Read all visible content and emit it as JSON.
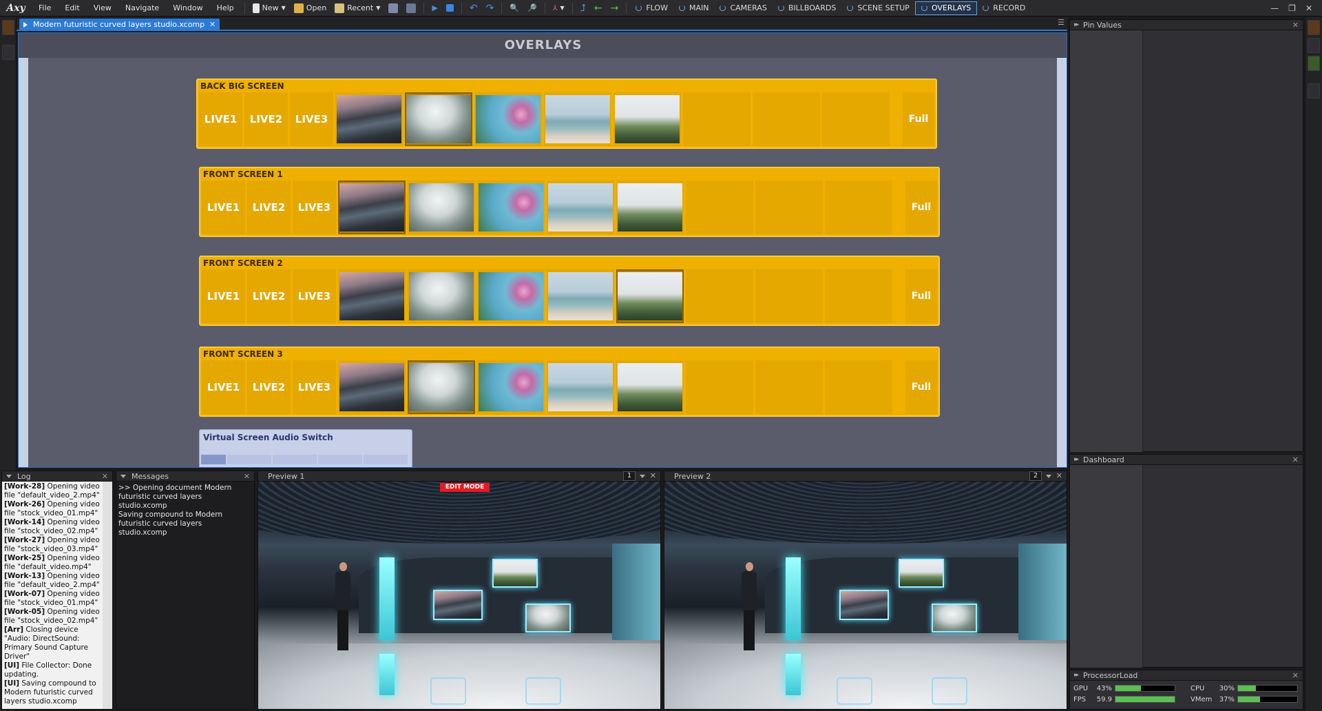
{
  "app": {
    "logo": "Axy"
  },
  "menu": {
    "file": "File",
    "edit": "Edit",
    "view": "View",
    "navigate": "Navigate",
    "window": "Window",
    "help": "Help"
  },
  "toolbar": {
    "new": "New",
    "open": "Open",
    "recent": "Recent"
  },
  "nav": {
    "flow": "FLOW",
    "main": "MAIN",
    "cameras": "CAMERAS",
    "billboards": "BILLBOARDS",
    "scene_setup": "SCENE SETUP",
    "overlays": "OVERLAYS",
    "record": "RECORD"
  },
  "document": {
    "tab": "Modern futuristic curved layers studio.xcomp"
  },
  "canvas": {
    "title": "OVERLAYS"
  },
  "screens": [
    {
      "title": "BACK BIG SCREEN",
      "live": [
        "LIVE1",
        "LIVE2",
        "LIVE3"
      ],
      "full": "Full"
    },
    {
      "title": "FRONT SCREEN 1",
      "live": [
        "LIVE1",
        "LIVE2",
        "LIVE3"
      ],
      "full": "Full"
    },
    {
      "title": "FRONT SCREEN 2",
      "live": [
        "LIVE1",
        "LIVE2",
        "LIVE3"
      ],
      "full": "Full"
    },
    {
      "title": "FRONT SCREEN 3",
      "live": [
        "LIVE1",
        "LIVE2",
        "LIVE3"
      ],
      "full": "Full"
    }
  ],
  "audio_switch": {
    "title": "Virtual Screen Audio Switch"
  },
  "panels": {
    "pin_values": "Pin Values",
    "dashboard": "Dashboard",
    "processor_load": "ProcessorLoad",
    "log": "Log",
    "messages": "Messages",
    "preview1": "Preview 1",
    "preview2": "Preview 2",
    "preview1_num": "1",
    "preview2_num": "2",
    "edit_mode": "EDIT MODE"
  },
  "log": [
    {
      "tag": "[Work-28]",
      "text": " Opening video file \"default_video_2.mp4\""
    },
    {
      "tag": "[Work-26]",
      "text": " Opening video file \"stock_video_01.mp4\""
    },
    {
      "tag": "[Work-14]",
      "text": " Opening video file \"stock_video_02.mp4\""
    },
    {
      "tag": "[Work-27]",
      "text": " Opening video file \"stock_video_03.mp4\""
    },
    {
      "tag": "[Work-25]",
      "text": " Opening video file \"default_video.mp4\""
    },
    {
      "tag": "[Work-13]",
      "text": " Opening video file \"default_video_2.mp4\""
    },
    {
      "tag": "[Work-07]",
      "text": " Opening video file \"stock_video_01.mp4\""
    },
    {
      "tag": "[Work-05]",
      "text": " Opening video file \"stock_video_02.mp4\""
    },
    {
      "tag": "[Arr]",
      "text": " Closing device \"Audio: DirectSound: Primary Sound Capture Driver\""
    },
    {
      "tag": "[UI]",
      "text": " File Collector: Done updating."
    },
    {
      "tag": "[UI]",
      "text": " Saving compound to Modern futuristic curved layers studio.xcomp"
    }
  ],
  "messages": {
    "line1": ">> Opening document Modern futuristic curved layers studio.xcomp",
    "line2": "Saving compound to Modern futuristic curved layers studio.xcomp"
  },
  "processor": {
    "gpu_label": "GPU",
    "gpu_value": "43%",
    "gpu_pct": 43,
    "fps_label": "FPS",
    "fps_value": "59.9",
    "fps_pct": 100,
    "cpu_label": "CPU",
    "cpu_value": "30%",
    "cpu_pct": 30,
    "vmem_label": "VMem",
    "vmem_value": "37%",
    "vmem_pct": 37
  },
  "colors": {
    "accent": "#2b7bd6",
    "screen_panel": "#f0b000",
    "edit_badge": "#e31b23"
  }
}
